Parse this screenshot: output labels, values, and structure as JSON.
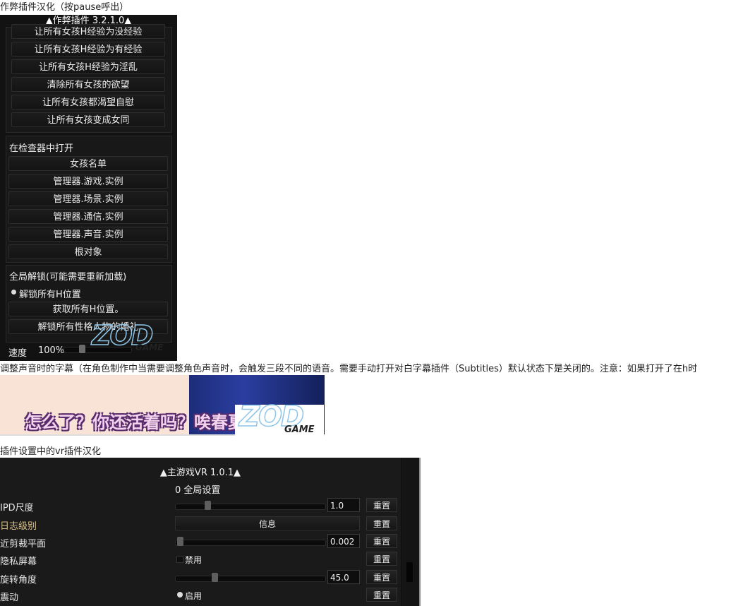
{
  "captions": {
    "cheat": "作弊插件汉化（按pause呼出）",
    "subtitle": "调整声音时的字幕（在角色制作中当需要调整角色声音时，会触发三段不同的语音。需要手动打开对白字幕插件（Subtitles）默认状态下是关闭的。注意：如果打开了在h时",
    "vr": "插件设置中的vr插件汉化"
  },
  "cheat": {
    "title": "▲作弊插件 3.2.1.0▲",
    "h_buttons": [
      "让所有女孩H经验为没经验",
      "让所有女孩H经验为有经验",
      "让所有女孩H经验为淫乱",
      "清除所有女孩的欲望",
      "让所有女孩都渴望自慰",
      "让所有女孩变成女同"
    ],
    "inspector": {
      "label": "在检查器中打开",
      "buttons": [
        "女孩名单",
        "管理器.游戏.实例",
        "管理器.场景.实例",
        "管理器.通信.实例",
        "管理器.声音.实例",
        "根对象"
      ]
    },
    "unlock": {
      "label": "全局解锁(可能需要重新加载)",
      "radio_label": "解锁所有H位置",
      "buttons": [
        "获取所有H位置。",
        "解锁所有性格人物的婚礼"
      ]
    },
    "speed": {
      "label": "速度",
      "value": "100%"
    }
  },
  "logo": {
    "main": "ZOD",
    "sub": "GAME"
  },
  "subtitle_image": {
    "text": "怎么了？你还活着吗？唉春夏"
  },
  "vr": {
    "title": "▲主游戏VR 1.0.1▲",
    "section": "0 全局设置",
    "reset_label": "重置",
    "rows": {
      "ipd": {
        "label": "IPD尺度",
        "value": "1.0"
      },
      "log": {
        "label": "日志级别",
        "value": "信息"
      },
      "near": {
        "label": "近剪裁平面",
        "value": "0.002"
      },
      "privacy": {
        "label": "隐私屏幕",
        "value": "禁用"
      },
      "rotate": {
        "label": "旋转角度",
        "value": "45.0"
      },
      "vibrate": {
        "label": "震动",
        "value": "启用"
      }
    }
  },
  "colors": {
    "panel": "#121212",
    "gold_label": "#d8c08a",
    "logo_blue": "#8ec5e8"
  }
}
